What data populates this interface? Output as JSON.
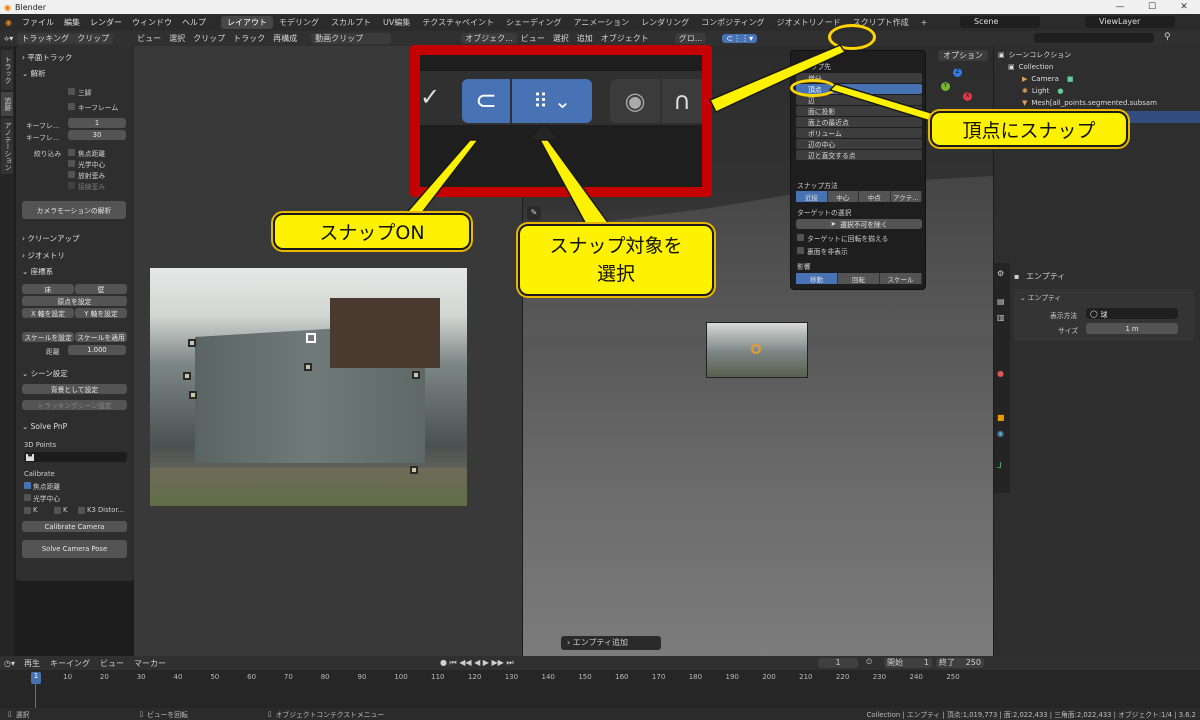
{
  "window": {
    "title": "Blender"
  },
  "menu": {
    "items": [
      "ファイル",
      "編集",
      "レンダー",
      "ウィンドウ",
      "ヘルプ"
    ],
    "workspaces": [
      "レイアウト",
      "モデリング",
      "スカルプト",
      "UV編集",
      "テクスチャペイント",
      "シェーディング",
      "アニメーション",
      "レンダリング",
      "コンポジティング",
      "ジオメトリノード",
      "スクリプト作成"
    ],
    "active_workspace": "レイアウト",
    "scene": "Scene",
    "view_layer": "ViewLayer"
  },
  "clip_header": {
    "mode": "トラッキング",
    "clip_menu": "クリップ",
    "items": [
      "ビュー",
      "選択",
      "クリップ",
      "トラック",
      "再構成"
    ],
    "clip_name": "動画クリップ"
  },
  "viewport_header": {
    "mode": "オブジェク...",
    "items": [
      "ビュー",
      "選択",
      "追加",
      "オブジェクト"
    ],
    "orientation": "グロ...",
    "options": "オプション"
  },
  "left_tabs": [
    "トラック",
    "追跡",
    "アノテーション"
  ],
  "sidebar": {
    "plane_track": "平面トラック",
    "solve": "解析",
    "tripod": "三脚",
    "keyframe": "キーフレーム",
    "keyframe_a_label": "キーフレ...",
    "keyframe_a_value": "1",
    "keyframe_b_label": "キーフレ...",
    "keyframe_b_value": "30",
    "refine_label": "絞り込み",
    "refine_focal": "焦点距離",
    "refine_center": "光学中心",
    "refine_radial": "放射歪み",
    "refine_tangent": "接線歪み",
    "solve_button": "カメラモーションの解析",
    "cleanup": "クリーンアップ",
    "geometry": "ジオメトリ",
    "orientation": "座標系",
    "floor": "床",
    "wall": "壁",
    "set_origin": "原点を設定",
    "x_axis": "X 軸を設定",
    "y_axis": "Y 軸を設定",
    "set_scale": "スケールを設定",
    "apply_scale": "スケールを適用",
    "distance_label": "距離",
    "distance_value": "1.000",
    "scene_setup": "シーン設定",
    "set_background": "背景として設定",
    "tracking_scene": "トラッキングシーン設定",
    "solve_pnp": "Solve PnP",
    "points_3d": "3D Points",
    "calibrate": "Calibrate",
    "cal_focal": "焦点距離",
    "cal_center": "光学中心",
    "k1": "K",
    "k2": "K",
    "k3": "K3 Distor...",
    "calibrate_camera": "Calibrate Camera",
    "solve_camera_pose": "Solve Camera Pose"
  },
  "snap_popup": {
    "title": "スナップ先",
    "targets": [
      "増分",
      "頂点",
      "辺",
      "面に投影",
      "面上の最近点",
      "ボリューム",
      "辺の中心",
      "辺と直交する点"
    ],
    "selected_target": "頂点",
    "method_label": "スナップ方法",
    "methods": [
      "近接",
      "中心",
      "中点",
      "アクテ..."
    ],
    "target_selection_label": "ターゲットの選択",
    "exclude_non_selectable": "選択不可を除く",
    "align_rotation": "ターゲットに回転を揃える",
    "backface_culling": "裏面を非表示",
    "affect_label": "影響",
    "affect": [
      "移動",
      "回転",
      "スケール"
    ]
  },
  "outliner": {
    "scene_collection": "シーンコレクション",
    "collection": "Collection",
    "camera": "Camera",
    "light": "Light",
    "mesh": "Mesh[all_points.segmented.subsam"
  },
  "properties": {
    "object_name": "エンプティ",
    "panel": "エンプティ",
    "display_label": "表示方法",
    "display_value": "球",
    "size_label": "サイズ",
    "size_value": "1 m"
  },
  "viewport": {
    "last_op": "エンプティ追加"
  },
  "timeline": {
    "menus": [
      "再生",
      "キーイング",
      "ビュー",
      "マーカー"
    ],
    "current": "1",
    "start_label": "開始",
    "start": "1",
    "end_label": "終了",
    "end": "250",
    "ticks": [
      "1",
      "10",
      "20",
      "30",
      "40",
      "50",
      "60",
      "70",
      "80",
      "90",
      "100",
      "110",
      "120",
      "130",
      "140",
      "150",
      "160",
      "170",
      "180",
      "190",
      "200",
      "210",
      "220",
      "230",
      "240",
      "250"
    ]
  },
  "status": {
    "select": "選択",
    "rotate_view": "ビューを回転",
    "context_menu": "オブジェクトコンテクストメニュー",
    "stats": "Collection | エンプティ | 頂点:1,019,773 | 面:2,022,433 | 三角面:2,022,433 | オブジェクト:1/4 | 3.6.2"
  },
  "callouts": {
    "snap_on": "スナップON",
    "snap_target": "スナップ対象を\n選択",
    "snap_vertex": "頂点にスナップ"
  },
  "colors": {
    "accent": "#4772b3",
    "callout": "#fff200",
    "highlight_red": "#c40000"
  }
}
